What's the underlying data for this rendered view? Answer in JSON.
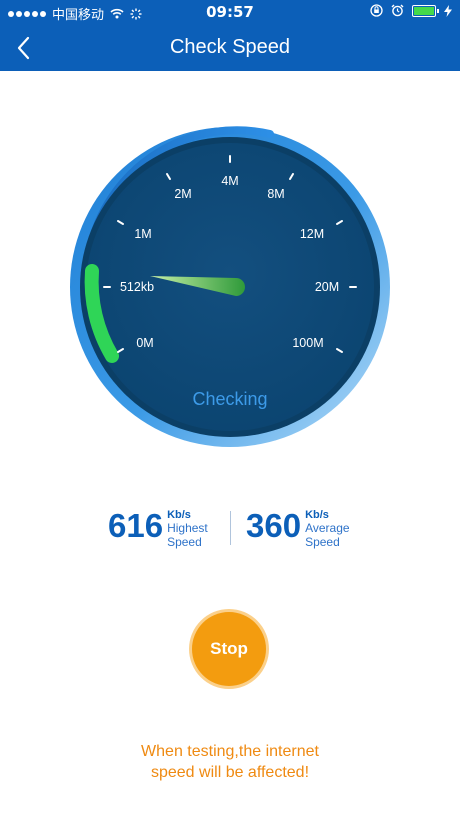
{
  "status_bar": {
    "carrier": "中国移动",
    "time": "09:57"
  },
  "nav": {
    "title": "Check Speed"
  },
  "gauge": {
    "tick_labels": [
      "0M",
      "512kb",
      "1M",
      "2M",
      "4M",
      "8M",
      "12M",
      "20M",
      "100M"
    ],
    "status_text": "Checking",
    "progress_fraction": 0.18,
    "colors": {
      "face": "#0f4f7d",
      "ring_outer": "#2b8fe0",
      "needle": "#3aa536",
      "progress": "#2fd557",
      "status_text": "#3d9be9"
    }
  },
  "stats": {
    "highest": {
      "value": "616",
      "unit": "Kb/s",
      "label_line1": "Highest",
      "label_line2": "Speed"
    },
    "average": {
      "value": "360",
      "unit": "Kb/s",
      "label_line1": "Average",
      "label_line2": "Speed"
    }
  },
  "stop_button": {
    "label": "Stop",
    "color": "#f39c0f"
  },
  "warning": {
    "line1": "When testing,the internet",
    "line2": "speed will be affected!"
  }
}
